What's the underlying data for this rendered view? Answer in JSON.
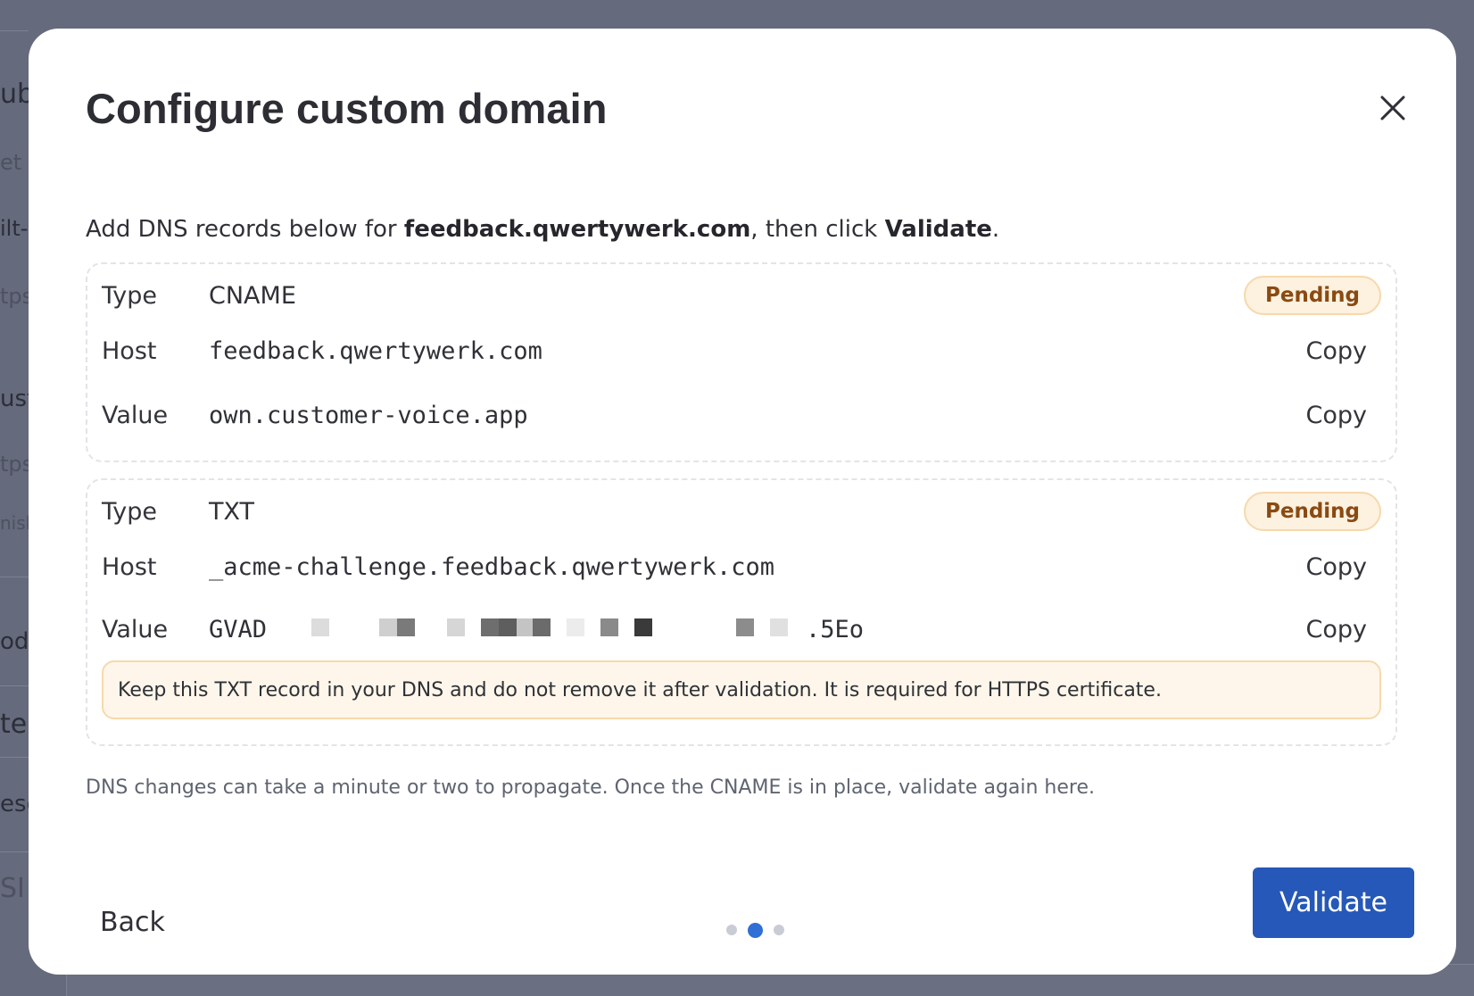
{
  "background": {
    "fragments": [
      "ubl",
      "et u",
      "ilt-",
      "tps",
      "ust",
      "tps",
      "nish",
      "od",
      "te",
      "esc",
      "SI"
    ]
  },
  "modal": {
    "title": "Configure custom domain",
    "intro": {
      "prefix": "Add DNS records below for ",
      "domain": "feedback.qwertywerk.com",
      "middle": ", then click ",
      "action": "Validate",
      "suffix": "."
    },
    "labels": {
      "type": "Type",
      "host": "Host",
      "value": "Value",
      "copy": "Copy"
    },
    "records": [
      {
        "type": "CNAME",
        "status": "Pending",
        "host": "feedback.qwertywerk.com",
        "value": "own.customer-voice.app"
      },
      {
        "type": "TXT",
        "status": "Pending",
        "host": "_acme-challenge.feedback.qwertywerk.com",
        "value_start": "GVAD",
        "value_end": ".5Eo",
        "warning": "Keep this TXT record in your DNS and do not remove it after validation. It is required for HTTPS certificate."
      }
    ],
    "note": "DNS changes can take a minute or two to propagate. Once the CNAME is in place, validate again here.",
    "footer": {
      "back_label": "Back",
      "validate_label": "Validate",
      "step_current": 2,
      "step_total": 3
    }
  },
  "colors": {
    "primary": "#2558b8",
    "pending_bg": "#fdf1df",
    "pending_text": "#8a4a12",
    "step_active": "#2f6fd6"
  }
}
